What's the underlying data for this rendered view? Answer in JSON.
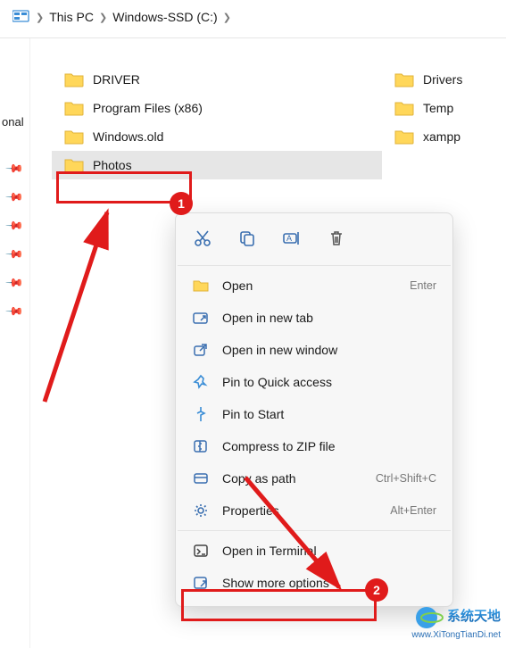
{
  "breadcrumb": {
    "items": [
      "This PC",
      "Windows-SSD (C:)"
    ]
  },
  "sidebar": {
    "label_fragment": "onal"
  },
  "folders": {
    "left": [
      {
        "name": "DRIVER"
      },
      {
        "name": "Program Files (x86)"
      },
      {
        "name": "Windows.old"
      },
      {
        "name": "Photos",
        "selected": true
      }
    ],
    "right": [
      {
        "name": "Drivers"
      },
      {
        "name": "Temp"
      },
      {
        "name": "xampp"
      }
    ]
  },
  "context_menu": {
    "icon_row": [
      "cut",
      "copy",
      "rename",
      "delete"
    ],
    "items": [
      {
        "icon": "folder-open",
        "label": "Open",
        "accel": "Enter"
      },
      {
        "icon": "tab",
        "label": "Open in new tab"
      },
      {
        "icon": "external",
        "label": "Open in new window"
      },
      {
        "icon": "pin-quick",
        "label": "Pin to Quick access"
      },
      {
        "icon": "pin-start",
        "label": "Pin to Start"
      },
      {
        "icon": "zip",
        "label": "Compress to ZIP file"
      },
      {
        "icon": "copypath",
        "label": "Copy as path",
        "accel": "Ctrl+Shift+C"
      },
      {
        "icon": "properties",
        "label": "Properties",
        "accel": "Alt+Enter"
      }
    ],
    "footer": [
      {
        "icon": "terminal",
        "label": "Open in Terminal"
      },
      {
        "icon": "more",
        "label": "Show more options"
      }
    ]
  },
  "annotations": {
    "badge1": "1",
    "badge2": "2"
  },
  "watermark": {
    "line1": "系统天地",
    "line2": "www.XiTongTianDi.net"
  }
}
